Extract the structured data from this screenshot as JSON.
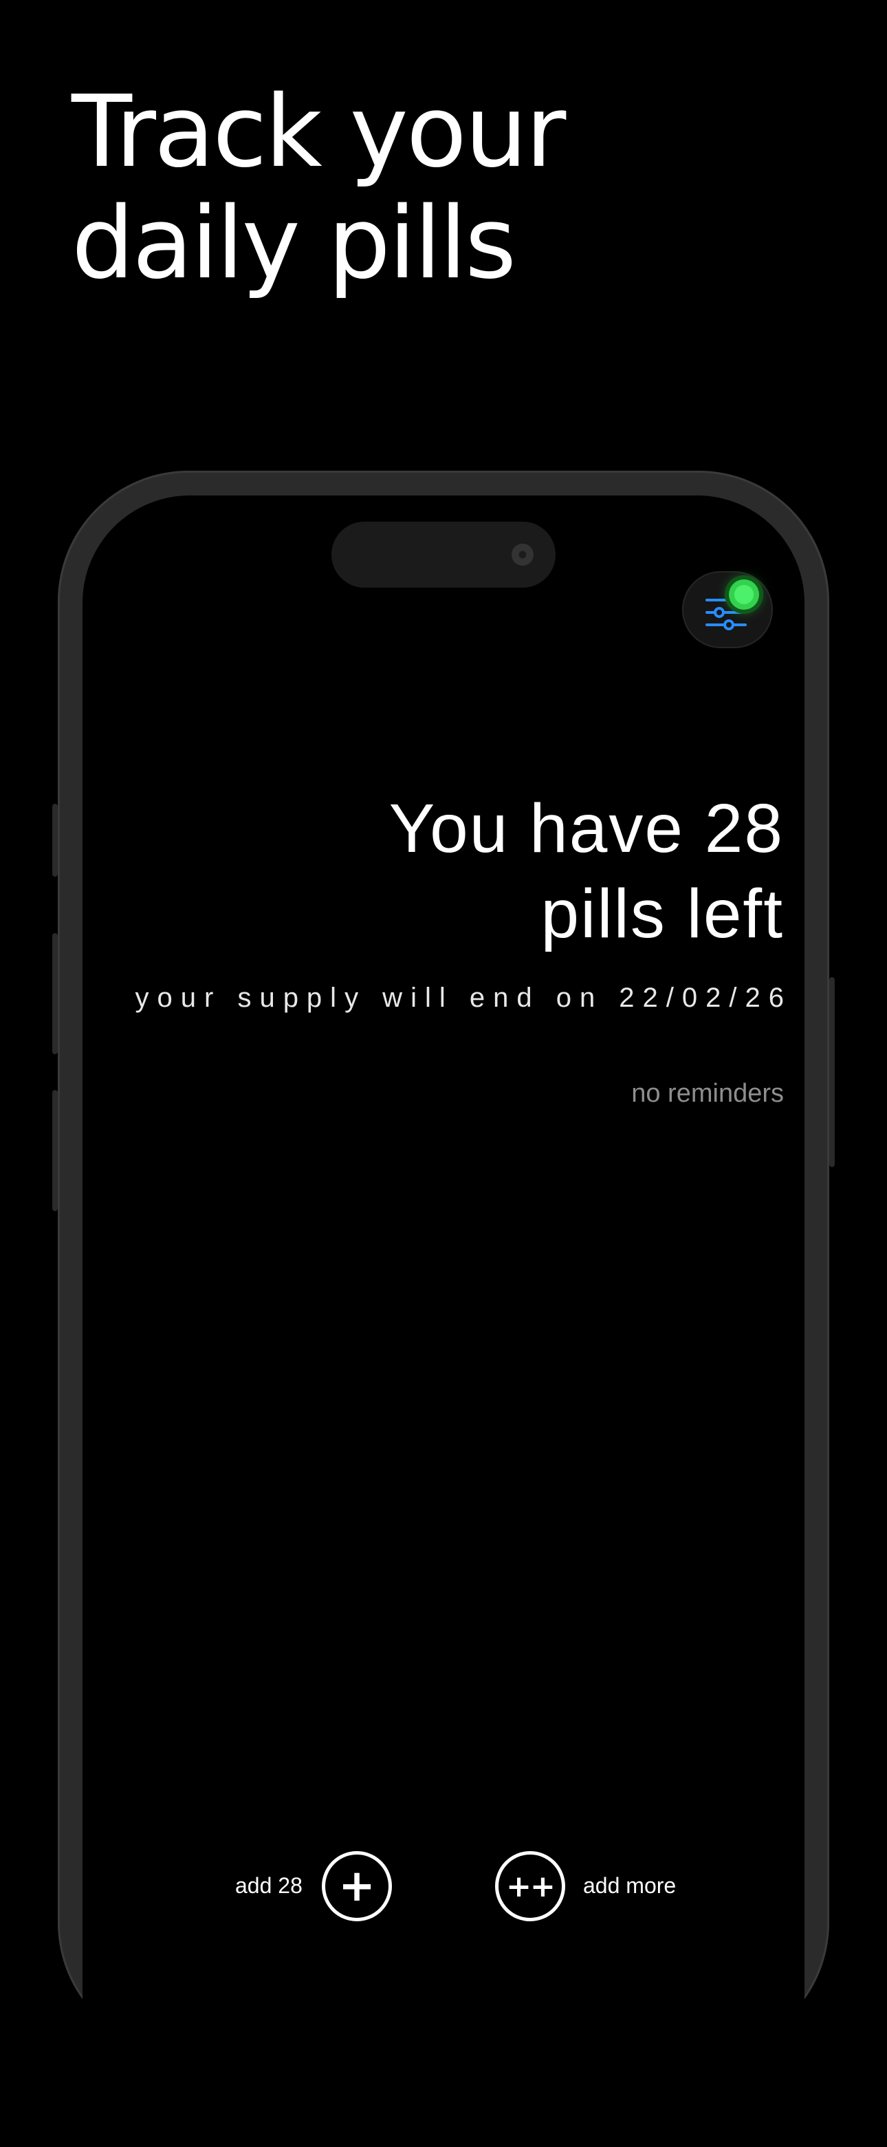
{
  "promo": {
    "headline_line1": "Track your",
    "headline_line2": "daily pills"
  },
  "app": {
    "menu_icon": "sliders-icon",
    "status_indicator_color": "#34d14e",
    "accent_color": "#2a8cff",
    "pill_count_line1": "You have 28",
    "pill_count_line2": "pills left",
    "supply_end_text": "your supply will end on 22/02/26",
    "reminders_text": "no reminders"
  },
  "actions": {
    "add_fixed_label": "add 28",
    "add_fixed_glyph": "+",
    "add_more_label": "add more",
    "add_more_glyph": "++"
  }
}
